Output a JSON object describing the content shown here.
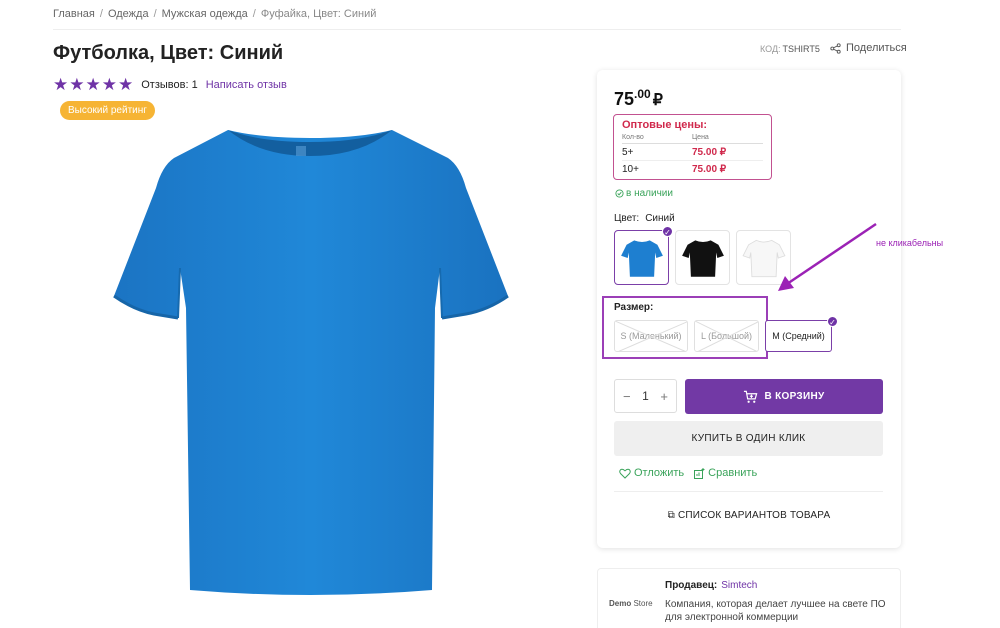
{
  "breadcrumb": [
    "Главная",
    "Одежда",
    "Мужская одежда",
    "Фуфайка, Цвет: Синий"
  ],
  "product": {
    "title": "Футболка, Цвет: Синий",
    "sku_label": "КОД:",
    "sku_value": "TSHIRT5",
    "share_label": "Поделиться",
    "rating_stars": 5,
    "reviews_label": "Отзывов: 1",
    "write_review": "Написать отзыв",
    "badge": "Высокий рейтинг",
    "image_color": "#1e7fd0"
  },
  "buy": {
    "price_main": "75",
    "price_cents": ".00",
    "currency": "₽",
    "wholesale": {
      "title": "Оптовые цены:",
      "col_qty": "Кол-во",
      "col_price": "Цена",
      "rows": [
        {
          "qty": "5+",
          "price": "75.00 ₽"
        },
        {
          "qty": "10+",
          "price": "75.00 ₽"
        }
      ]
    },
    "stock": "в наличии",
    "color_label": "Цвет:",
    "color_value": "Синий",
    "color_options": [
      "blue",
      "black",
      "white"
    ],
    "size_label": "Размер:",
    "sizes": [
      "S (Маленький)",
      "L (Большой)",
      "M (Средний)"
    ],
    "quantity": "1",
    "qty_minus": "−",
    "qty_plus": "+",
    "cart_label": "В КОРЗИНУ",
    "oneclick_label": "КУПИТЬ В ОДИН КЛИК",
    "wishlist_label": "Отложить",
    "compare_label": "Сравнить",
    "variants_label": "СПИСОК ВАРИАНТОВ ТОВАРА"
  },
  "annotation": {
    "text": "не кликабельны",
    "color": "#9b22b5"
  },
  "seller": {
    "logo": "Demo",
    "logo_suffix": "Store",
    "title": "Продавец:",
    "name": "Simtech",
    "description": "Компания, которая делает лучшее на свете ПО для электронной коммерции"
  },
  "colors": {
    "accent": "#7239a5",
    "stock_green": "#3aa35a",
    "price_red": "#d0294c",
    "badge_orange": "#f6b434"
  }
}
